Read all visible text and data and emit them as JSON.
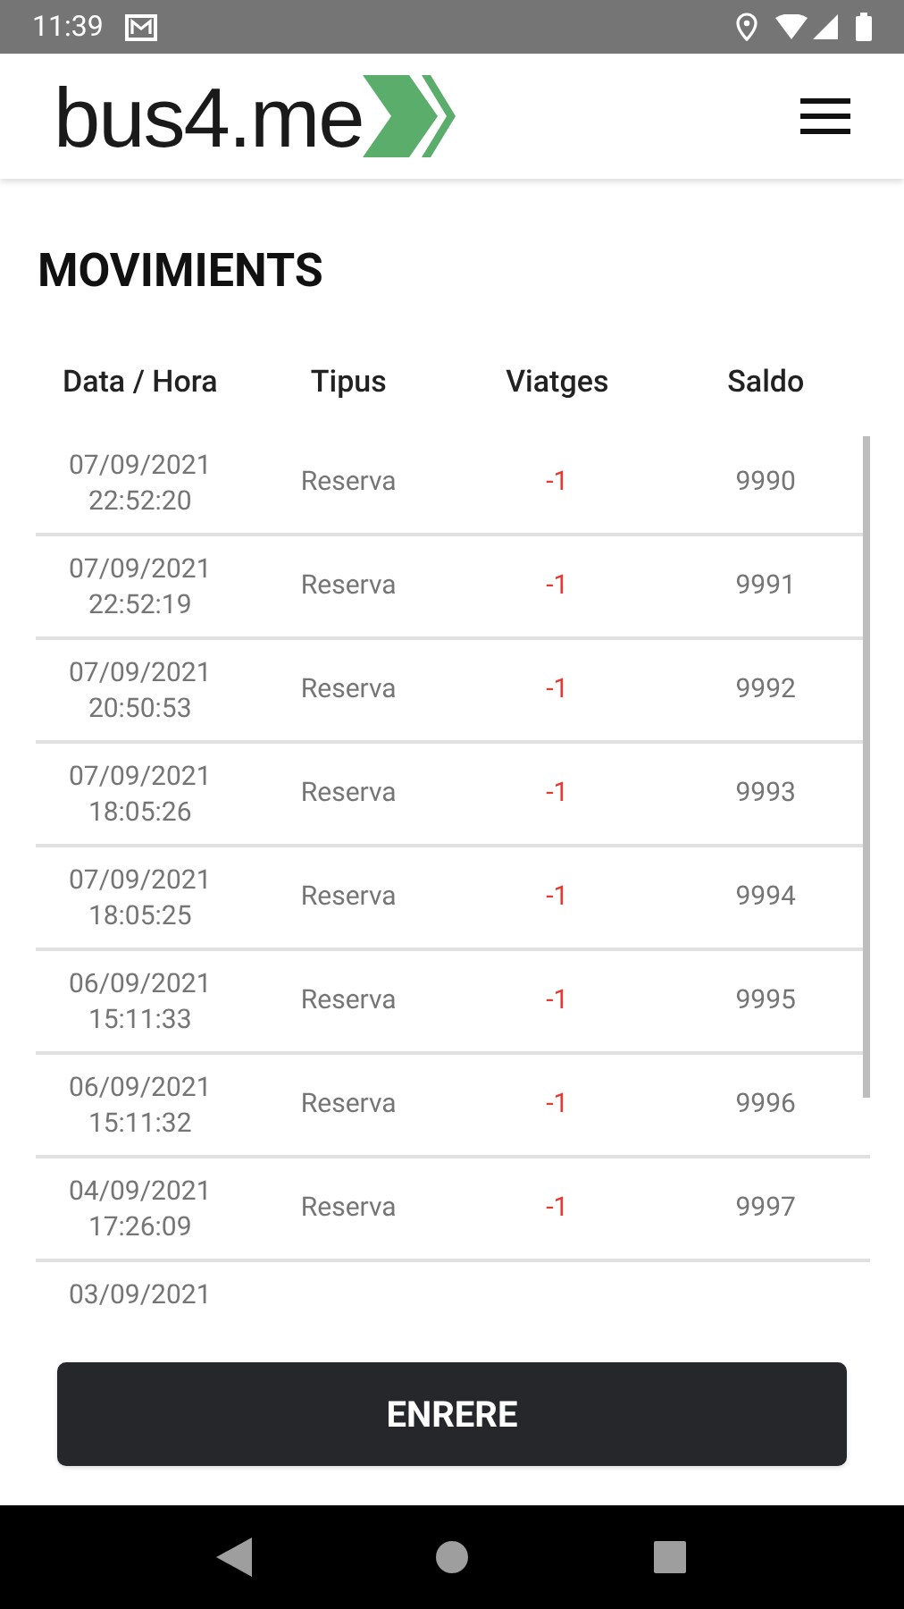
{
  "status_bar": {
    "time": "11:39"
  },
  "header": {
    "logo": "bus4.me"
  },
  "page": {
    "title": "MOVIMIENTS"
  },
  "table": {
    "columns": [
      "Data / Hora",
      "Tipus",
      "Viatges",
      "Saldo"
    ],
    "rows": [
      {
        "date": "07/09/2021",
        "time": "22:52:20",
        "type": "Reserva",
        "trips": "-1",
        "balance": "9990"
      },
      {
        "date": "07/09/2021",
        "time": "22:52:19",
        "type": "Reserva",
        "trips": "-1",
        "balance": "9991"
      },
      {
        "date": "07/09/2021",
        "time": "20:50:53",
        "type": "Reserva",
        "trips": "-1",
        "balance": "9992"
      },
      {
        "date": "07/09/2021",
        "time": "18:05:26",
        "type": "Reserva",
        "trips": "-1",
        "balance": "9993"
      },
      {
        "date": "07/09/2021",
        "time": "18:05:25",
        "type": "Reserva",
        "trips": "-1",
        "balance": "9994"
      },
      {
        "date": "06/09/2021",
        "time": "15:11:33",
        "type": "Reserva",
        "trips": "-1",
        "balance": "9995"
      },
      {
        "date": "06/09/2021",
        "time": "15:11:32",
        "type": "Reserva",
        "trips": "-1",
        "balance": "9996"
      },
      {
        "date": "04/09/2021",
        "time": "17:26:09",
        "type": "Reserva",
        "trips": "-1",
        "balance": "9997"
      },
      {
        "date": "03/09/2021"
      }
    ]
  },
  "back_button": "ENRERE"
}
